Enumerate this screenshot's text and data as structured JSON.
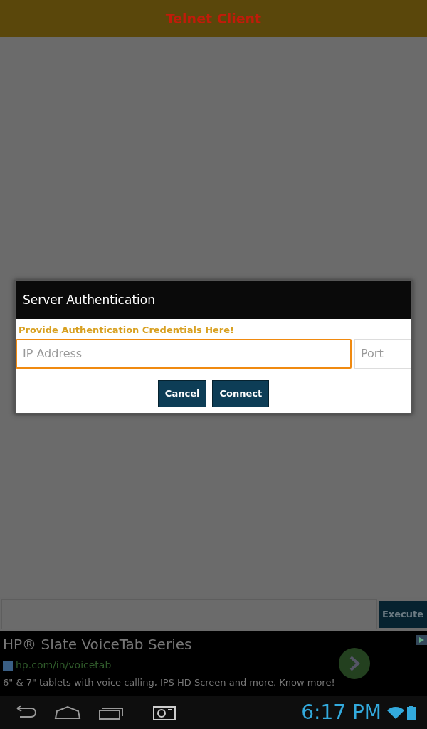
{
  "app_bar": {
    "title": "Telnet Client"
  },
  "dialog": {
    "title": "Server Authentication",
    "message": "Provide Authentication Credentials Here!",
    "fields": [
      {
        "placeholder": "IP Address",
        "focused": true
      },
      {
        "placeholder": "Port",
        "focused": false
      }
    ],
    "buttons": [
      "Cancel",
      "Connect"
    ]
  },
  "command_bar": {
    "button": "Execute"
  },
  "ad": {
    "headline": "HP® Slate VoiceTab Series",
    "url": "hp.com/in/voicetab",
    "description": "6\" & 7\" tablets with voice calling, IPS HD Screen and more. Know more!"
  },
  "system_bar": {
    "time": "6:17 PM"
  }
}
